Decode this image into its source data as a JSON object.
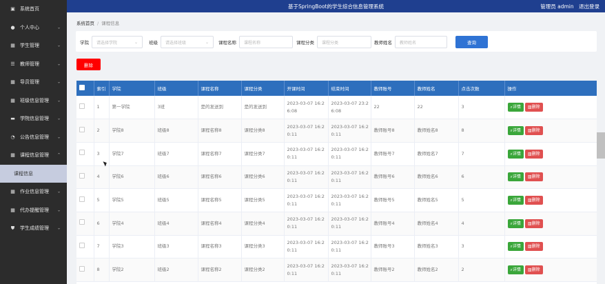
{
  "header": {
    "title": "基于SpringBoot的学生综合信息管理系统",
    "user_label": "管理员 admin",
    "logout_label": "退出登录"
  },
  "sidebar": {
    "items": [
      {
        "label": "系统首页",
        "icon": "home-icon",
        "chevron": false
      },
      {
        "label": "个人中心",
        "icon": "person-icon",
        "chevron": true
      },
      {
        "label": "学生管理",
        "icon": "grid-icon",
        "chevron": true
      },
      {
        "label": "教师管理",
        "icon": "sliders-icon",
        "chevron": true
      },
      {
        "label": "导员管理",
        "icon": "grid-icon",
        "chevron": true
      },
      {
        "label": "班级信息管理",
        "icon": "grid-icon",
        "chevron": true
      },
      {
        "label": "学院信息管理",
        "icon": "chat-icon",
        "chevron": true
      },
      {
        "label": "公告信息管理",
        "icon": "chart-icon",
        "chevron": true
      },
      {
        "label": "课程信息管理",
        "icon": "grid-icon",
        "chevron": true,
        "expanded": true
      }
    ],
    "sub_item": "课程信息",
    "items_after": [
      {
        "label": "作业信息管理",
        "icon": "grid-icon",
        "chevron": true
      },
      {
        "label": "代办提醒管理",
        "icon": "grid-icon",
        "chevron": true
      },
      {
        "label": "学生成绩管理",
        "icon": "shield-icon",
        "chevron": true
      }
    ]
  },
  "breadcrumb": {
    "home": "系统首页",
    "current": "课程信息"
  },
  "search": {
    "college_label": "学院",
    "college_placeholder": "请选择学院",
    "class_label": "班级",
    "class_placeholder": "请选择班级",
    "course_name_label": "课程名称",
    "course_name_placeholder": "课程名称",
    "course_category_label": "课程分类",
    "course_category_placeholder": "课程分类",
    "teacher_name_label": "教师姓名",
    "teacher_name_placeholder": "教师姓名",
    "query_label": "查询"
  },
  "delete_label": "删除",
  "table": {
    "headers": [
      "",
      "索引",
      "学院",
      "班级",
      "课程名称",
      "课程分类",
      "开课时间",
      "结束时间",
      "教师账号",
      "教师姓名",
      "点击次数",
      "操作"
    ],
    "detail_label": "详情",
    "delete_label": "删除",
    "rows": [
      {
        "index": "1",
        "college": "第一学院",
        "class": "3班",
        "course": "是的发送到",
        "category": "是的发送到",
        "start": "2023-03-07 16:2 6:08",
        "end": "2023-03-07 23:2 6:08",
        "account": "22",
        "teacher": "22",
        "clicks": "3"
      },
      {
        "index": "2",
        "college": "学院8",
        "class": "班级8",
        "course": "课程名称8",
        "category": "课程分类8",
        "start": "2023-03-07 16:2 0:11",
        "end": "2023-03-07 16:2 0:11",
        "account": "教师账号8",
        "teacher": "教师姓名8",
        "clicks": "8"
      },
      {
        "index": "3",
        "college": "学院7",
        "class": "班级7",
        "course": "课程名称7",
        "category": "课程分类7",
        "start": "2023-03-07 16:2 0:11",
        "end": "2023-03-07 16:2 0:11",
        "account": "教师账号7",
        "teacher": "教师姓名7",
        "clicks": "7"
      },
      {
        "index": "4",
        "college": "学院6",
        "class": "班级6",
        "course": "课程名称6",
        "category": "课程分类6",
        "start": "2023-03-07 16:2 0:11",
        "end": "2023-03-07 16:2 0:11",
        "account": "教师账号6",
        "teacher": "教师姓名6",
        "clicks": "6"
      },
      {
        "index": "5",
        "college": "学院5",
        "class": "班级5",
        "course": "课程名称5",
        "category": "课程分类5",
        "start": "2023-03-07 16:2 0:11",
        "end": "2023-03-07 16:2 0:11",
        "account": "教师账号5",
        "teacher": "教师姓名5",
        "clicks": "5"
      },
      {
        "index": "6",
        "college": "学院4",
        "class": "班级4",
        "course": "课程名称4",
        "category": "课程分类4",
        "start": "2023-03-07 16:2 0:11",
        "end": "2023-03-07 16:2 0:11",
        "account": "教师账号4",
        "teacher": "教师姓名4",
        "clicks": "4"
      },
      {
        "index": "7",
        "college": "学院3",
        "class": "班级3",
        "course": "课程名称3",
        "category": "课程分类3",
        "start": "2023-03-07 16:2 0:11",
        "end": "2023-03-07 16:2 0:11",
        "account": "教师账号3",
        "teacher": "教师姓名3",
        "clicks": "3"
      },
      {
        "index": "8",
        "college": "学院2",
        "class": "班级2",
        "course": "课程名称2",
        "category": "课程分类2",
        "start": "2023-03-07 16:2 0:11",
        "end": "2023-03-07 16:2 0:11",
        "account": "教师账号2",
        "teacher": "教师姓名2",
        "clicks": "2"
      }
    ]
  },
  "colors": {
    "sidebar_bg": "#2c2c2c",
    "header_bg": "#1f3f8f",
    "table_header_bg": "#2e6fbd",
    "query_button": "#2f73d4",
    "delete_button": "#ff0000",
    "detail_button": "#3aa63a",
    "row_delete_button": "#e05050"
  }
}
